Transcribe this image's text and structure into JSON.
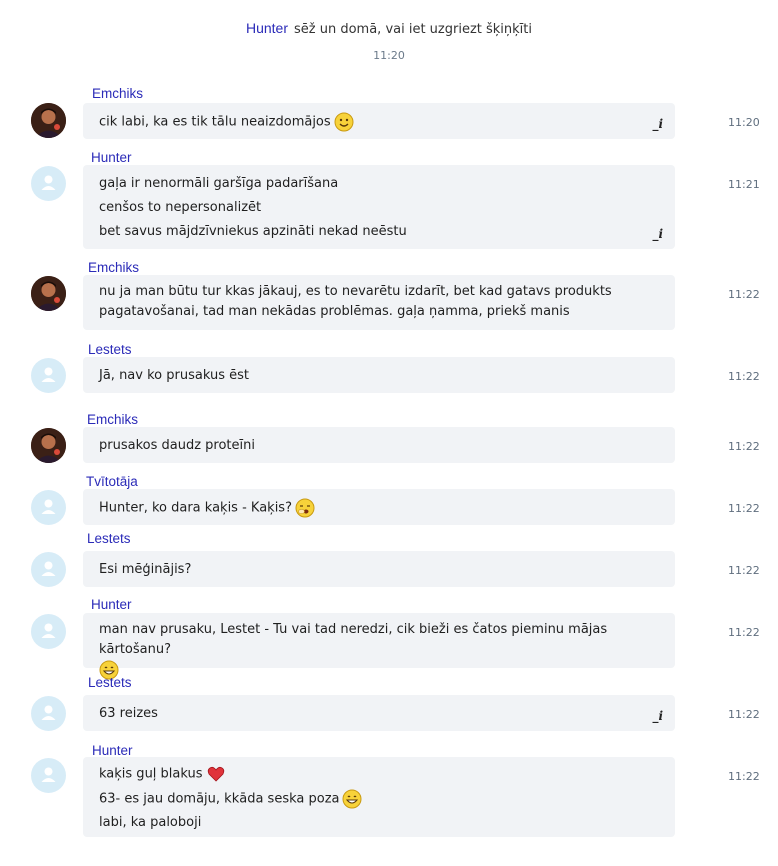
{
  "system": {
    "name": "Hunter",
    "text": "sēž un domā, vai iet uzgriezt šķiņķīti",
    "time": "11:20"
  },
  "messages": [
    {
      "sender": "Emchiks",
      "time": "11:20",
      "lines": [
        "cik labi, ka es tik tālu neaizdomājos"
      ],
      "edit_icon": "_i"
    },
    {
      "sender": "Hunter",
      "time": "11:21",
      "lines": [
        "gaļa ir nenormāli garšīga padarīšana",
        "cenšos to nepersonalizēt",
        "bet savus mājdzīvniekus apzināti nekad neēstu"
      ],
      "edit_icon": "_i"
    },
    {
      "sender": "Emchiks",
      "time": "11:22",
      "lines": [
        "nu ja man būtu tur kkas jākauj, es to nevarētu izdarīt, bet kad gatavs produkts",
        "pagatavošanai, tad man nekādas problēmas. gaļa ņamma, priekš manis"
      ]
    },
    {
      "sender": "Lestets",
      "time": "11:22",
      "lines": [
        "Jā, nav ko prusakus ēst"
      ]
    },
    {
      "sender": "Emchiks",
      "time": "11:22",
      "lines": [
        "prusakos daudz proteīni"
      ]
    },
    {
      "sender": "Tvītotāja",
      "time": "11:22",
      "lines": [
        "Hunter, ko dara kaķis - Kaķis?"
      ]
    },
    {
      "sender": "Lestets",
      "time": "11:22",
      "lines": [
        "Esi mēģinājis?"
      ]
    },
    {
      "sender": "Hunter",
      "time": "11:22",
      "lines": [
        "man nav prusaku, Lestet - Tu vai tad neredzi, cik bieži es čatos pieminu mājas kārtošanu?"
      ]
    },
    {
      "sender": "Lestets",
      "time": "11:22",
      "lines": [
        "63 reizes"
      ],
      "edit_icon": "_i"
    },
    {
      "sender": "Hunter",
      "time": "11:22",
      "lines": [
        "kaķis guļ blakus",
        "63- es jau domāju, kkāda seska poza",
        "labi, ka paloboji"
      ]
    }
  ],
  "emoji_names": {
    "smile": "smile-emoji",
    "yawn": "yawn-emoji",
    "grin": "grin-emoji",
    "heart": "heart-emoji"
  },
  "colors": {
    "sender_name": "#2b2bb8",
    "bubble_bg": "#f1f3f6",
    "avatar_default": "#d7ecf7",
    "time": "#5f6e7e"
  }
}
